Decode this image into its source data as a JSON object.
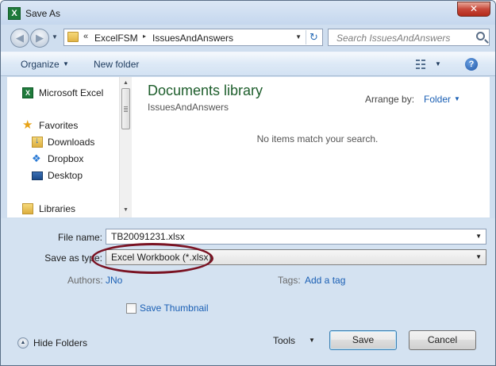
{
  "window": {
    "title": "Save As",
    "app_icon_letter": "X",
    "close_glyph": "✕"
  },
  "nav": {
    "back_glyph": "◀",
    "forward_glyph": "▶"
  },
  "address": {
    "chevron": "«",
    "crumbs": [
      "ExcelFSM",
      "IssuesAndAnswers"
    ],
    "separator": "▸",
    "refresh_glyph": "↻"
  },
  "search": {
    "placeholder": "Search IssuesAndAnswers"
  },
  "toolbar": {
    "organize_label": "Organize",
    "new_folder_label": "New folder",
    "help_glyph": "?"
  },
  "sidebar": {
    "items": [
      {
        "label": "Microsoft Excel",
        "icon": "excel-icon"
      },
      {
        "label": "Favorites",
        "icon": "star-icon"
      },
      {
        "label": "Downloads",
        "icon": "downloads-folder-icon"
      },
      {
        "label": "Dropbox",
        "icon": "dropbox-icon"
      },
      {
        "label": "Desktop",
        "icon": "desktop-icon"
      },
      {
        "label": "Libraries",
        "icon": "libraries-icon"
      }
    ]
  },
  "content": {
    "title": "Documents library",
    "subtitle": "IssuesAndAnswers",
    "arrange_label": "Arrange by:",
    "arrange_value": "Folder",
    "empty_message": "No items match your search."
  },
  "form": {
    "file_name_label": "File name:",
    "file_name_value": "TB20091231.xlsx",
    "save_as_type_label": "Save as type:",
    "save_as_type_value": "Excel Workbook (*.xlsx)",
    "authors_label": "Authors:",
    "authors_value": "JNo",
    "tags_label": "Tags:",
    "tags_value": "Add a tag",
    "thumbnail_label": "Save Thumbnail"
  },
  "footer": {
    "hide_folders_label": "Hide Folders",
    "tools_label": "Tools",
    "save_label": "Save",
    "cancel_label": "Cancel"
  },
  "colors": {
    "annotation_circle": "#7a1323",
    "library_title": "#1e5e2c",
    "link": "#1a5fb4"
  }
}
